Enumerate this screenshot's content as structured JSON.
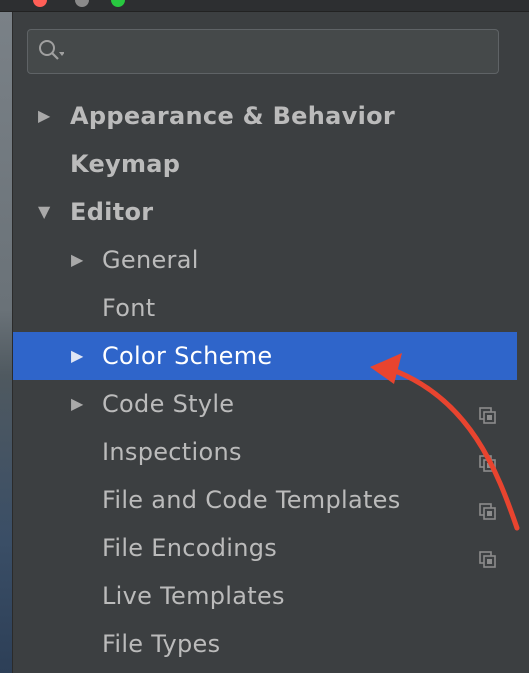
{
  "search": {
    "placeholder": ""
  },
  "tree": {
    "items": [
      {
        "label": "Appearance & Behavior",
        "arrow": "▶"
      },
      {
        "label": "Keymap"
      },
      {
        "label": "Editor",
        "arrow": "▼"
      },
      {
        "label": "General",
        "arrow": "▶"
      },
      {
        "label": "Font"
      },
      {
        "label": "Color Scheme",
        "arrow": "▶",
        "selected": true
      },
      {
        "label": "Code Style",
        "arrow": "▶"
      },
      {
        "label": "Inspections"
      },
      {
        "label": "File and Code Templates"
      },
      {
        "label": "File Encodings"
      },
      {
        "label": "Live Templates"
      },
      {
        "label": "File Types"
      }
    ]
  },
  "icons": {
    "search": "search-icon",
    "project_scope": "copy-icon",
    "annotation": "red-arrow"
  },
  "colors": {
    "background": "#3c3f41",
    "selection": "#2f65ca",
    "text": "#bbbbbb",
    "annotation": "#e8442f",
    "traffic_close": "#ff5f57",
    "traffic_min": "#8a8a8a",
    "traffic_max": "#28c840"
  }
}
